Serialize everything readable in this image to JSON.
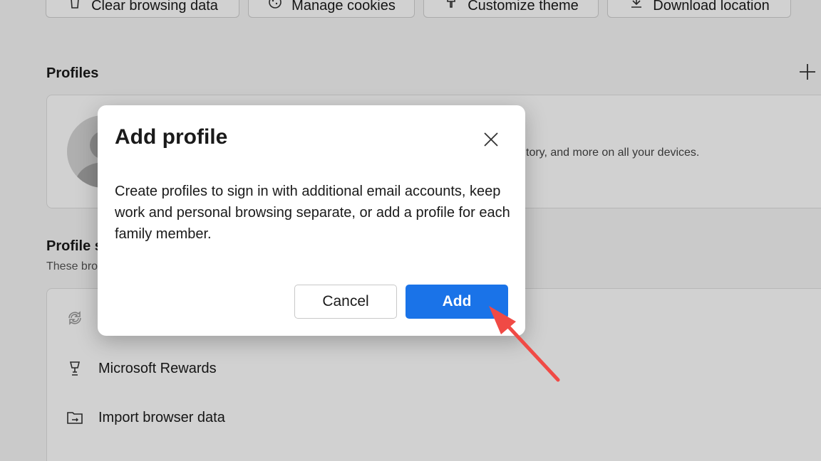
{
  "toolbar": {
    "buttons": [
      {
        "label": "Clear browsing data",
        "icon": "trash-icon"
      },
      {
        "label": "Manage cookies",
        "icon": "cookie-icon"
      },
      {
        "label": "Customize theme",
        "icon": "brush-icon"
      },
      {
        "label": "Download location",
        "icon": "download-icon"
      }
    ]
  },
  "profiles": {
    "title": "Profiles",
    "add_icon": "plus-icon",
    "description": "tory, and more on all your devices."
  },
  "profile_settings": {
    "title": "Profile s",
    "subtitle": "These bro",
    "items": [
      {
        "label": "",
        "icon": "sync-icon"
      },
      {
        "label": "Microsoft Rewards",
        "icon": "trophy-icon"
      },
      {
        "label": "Import browser data",
        "icon": "import-folder-icon"
      }
    ]
  },
  "dialog": {
    "title": "Add profile",
    "body": "Create profiles to sign in with additional email accounts, keep work and personal browsing separate, or add a profile for each family member.",
    "cancel_label": "Cancel",
    "add_label": "Add"
  },
  "colors": {
    "accent": "#1a73e8",
    "annotation_arrow": "#f04a45"
  }
}
